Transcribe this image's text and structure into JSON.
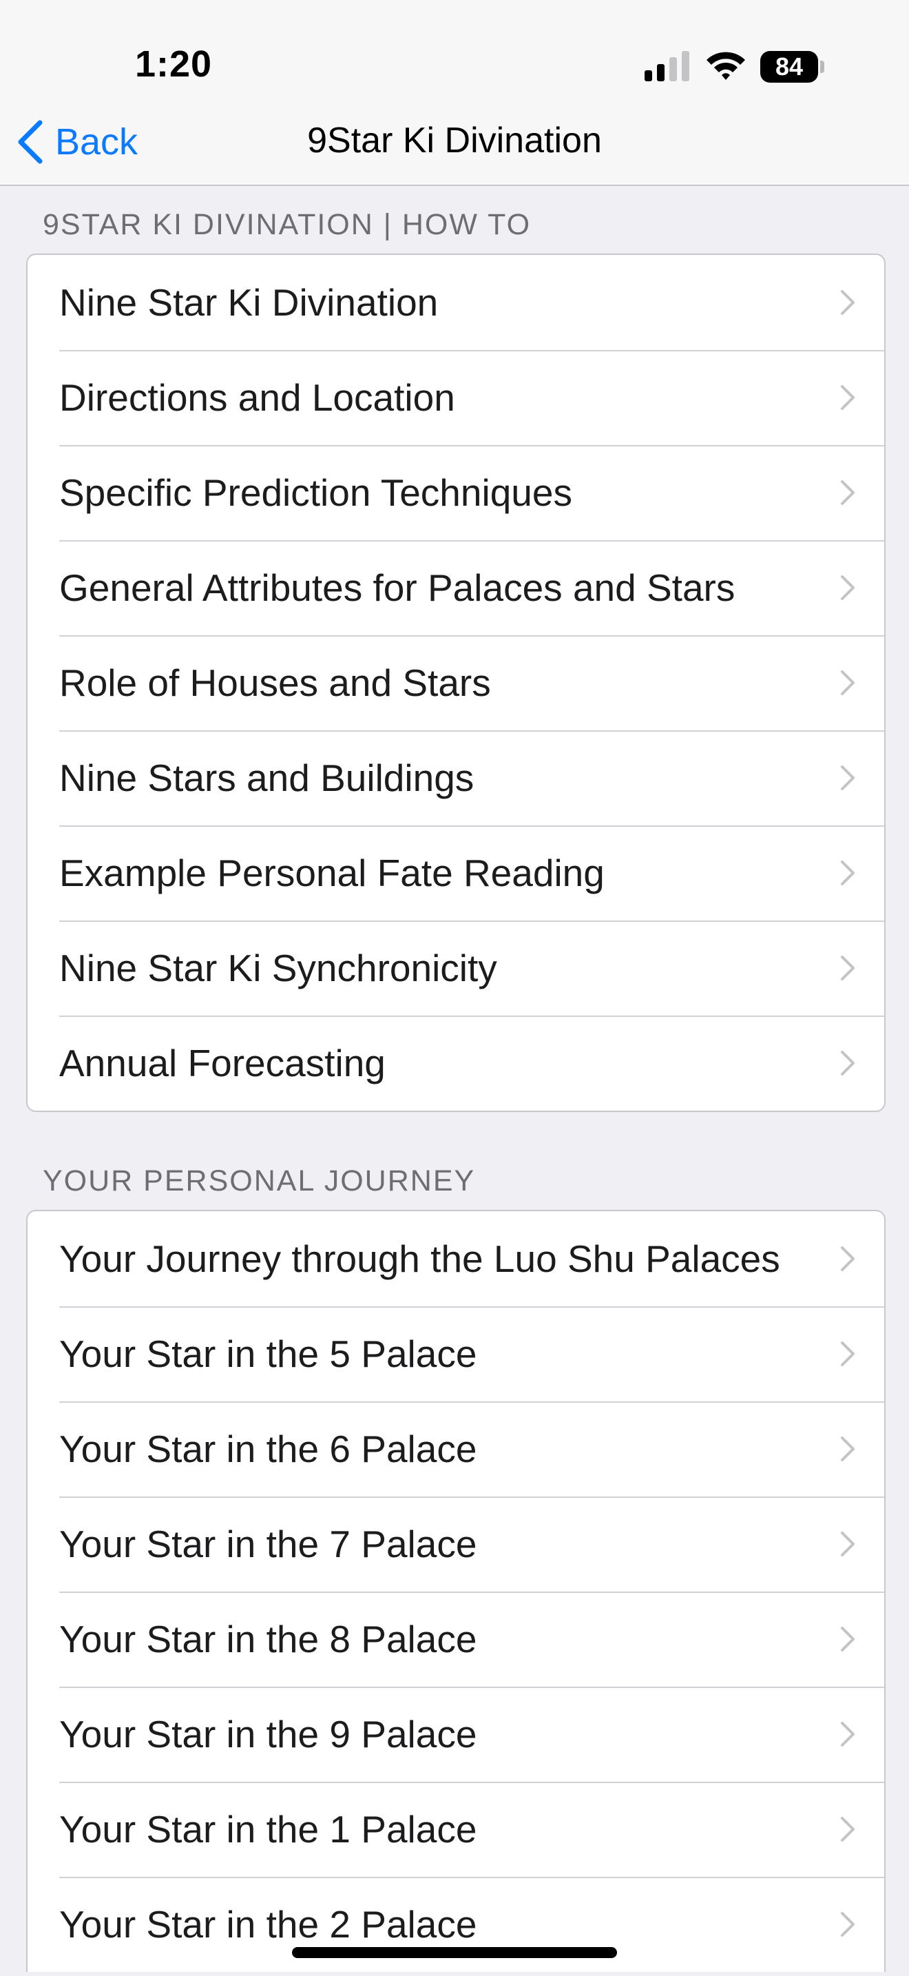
{
  "status_bar": {
    "time": "1:20",
    "battery": "84",
    "signal_icon": "cellular-signal-icon",
    "wifi_icon": "wifi-icon",
    "battery_icon": "battery-icon"
  },
  "nav": {
    "back_label": "Back",
    "back_icon": "chevron-left-icon",
    "title": "9Star Ki Divination",
    "accent_color": "#0a7aff"
  },
  "sections": [
    {
      "header": "9STAR KI DIVINATION | HOW TO",
      "items": [
        {
          "label": "Nine Star Ki Divination"
        },
        {
          "label": "Directions and Location"
        },
        {
          "label": "Specific Prediction Techniques"
        },
        {
          "label": "General Attributes for Palaces and Stars"
        },
        {
          "label": "Role of Houses and Stars"
        },
        {
          "label": "Nine Stars and Buildings"
        },
        {
          "label": "Example Personal Fate Reading"
        },
        {
          "label": "Nine Star Ki Synchronicity"
        },
        {
          "label": "Annual Forecasting"
        }
      ]
    },
    {
      "header": "YOUR PERSONAL JOURNEY",
      "items": [
        {
          "label": "Your Journey through the Luo Shu Palaces"
        },
        {
          "label": "Your Star in the 5 Palace"
        },
        {
          "label": "Your Star in the 6 Palace"
        },
        {
          "label": "Your Star in the 7 Palace"
        },
        {
          "label": "Your Star in the 8 Palace"
        },
        {
          "label": "Your Star in the 9 Palace"
        },
        {
          "label": "Your Star in the 1 Palace"
        },
        {
          "label": "Your Star in the 2 Palace"
        }
      ]
    }
  ],
  "row_chevron_icon": "chevron-right-icon"
}
